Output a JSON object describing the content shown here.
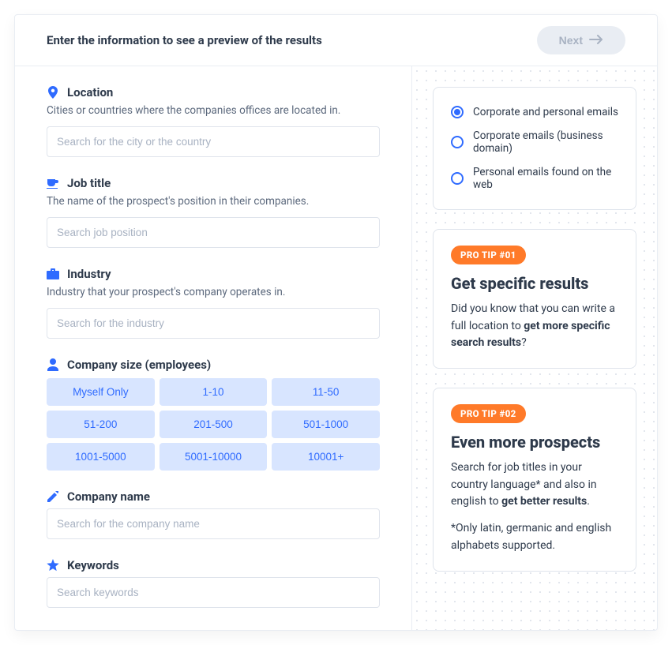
{
  "header": {
    "title": "Enter the information to see a preview of the results",
    "next_label": "Next"
  },
  "location": {
    "title": "Location",
    "desc": "Cities or countries where the companies offices are located in.",
    "placeholder": "Search for the city or the country"
  },
  "job_title": {
    "title": "Job title",
    "desc": "The name of the prospect's position in their companies.",
    "placeholder": "Search job position"
  },
  "industry": {
    "title": "Industry",
    "desc": "Industry that your prospect's company operates in.",
    "placeholder": "Search for the industry"
  },
  "company_size": {
    "title": "Company size (employees)",
    "options": [
      "Myself Only",
      "1-10",
      "11-50",
      "51-200",
      "201-500",
      "501-1000",
      "1001-5000",
      "5001-10000",
      "10001+"
    ]
  },
  "company_name": {
    "title": "Company name",
    "placeholder": "Search for the company name"
  },
  "keywords": {
    "title": "Keywords",
    "placeholder": "Search keywords"
  },
  "email_filter": {
    "options": [
      {
        "label": "Corporate and personal emails",
        "checked": true
      },
      {
        "label": "Corporate emails (business domain)",
        "checked": false
      },
      {
        "label": "Personal emails found on the web",
        "checked": false
      }
    ]
  },
  "tips": [
    {
      "badge": "PRO TIP #01",
      "title": "Get specific results",
      "body_pre": "Did you know that you can write a full location to ",
      "body_strong": "get more specific search results",
      "body_post": "?"
    },
    {
      "badge": "PRO TIP #02",
      "title": "Even more prospects",
      "body_pre": "Search for job titles in your country language* and also in english to ",
      "body_strong": "get better results",
      "body_post": ".",
      "footnote": "*Only latin, germanic and english alphabets supported."
    }
  ]
}
